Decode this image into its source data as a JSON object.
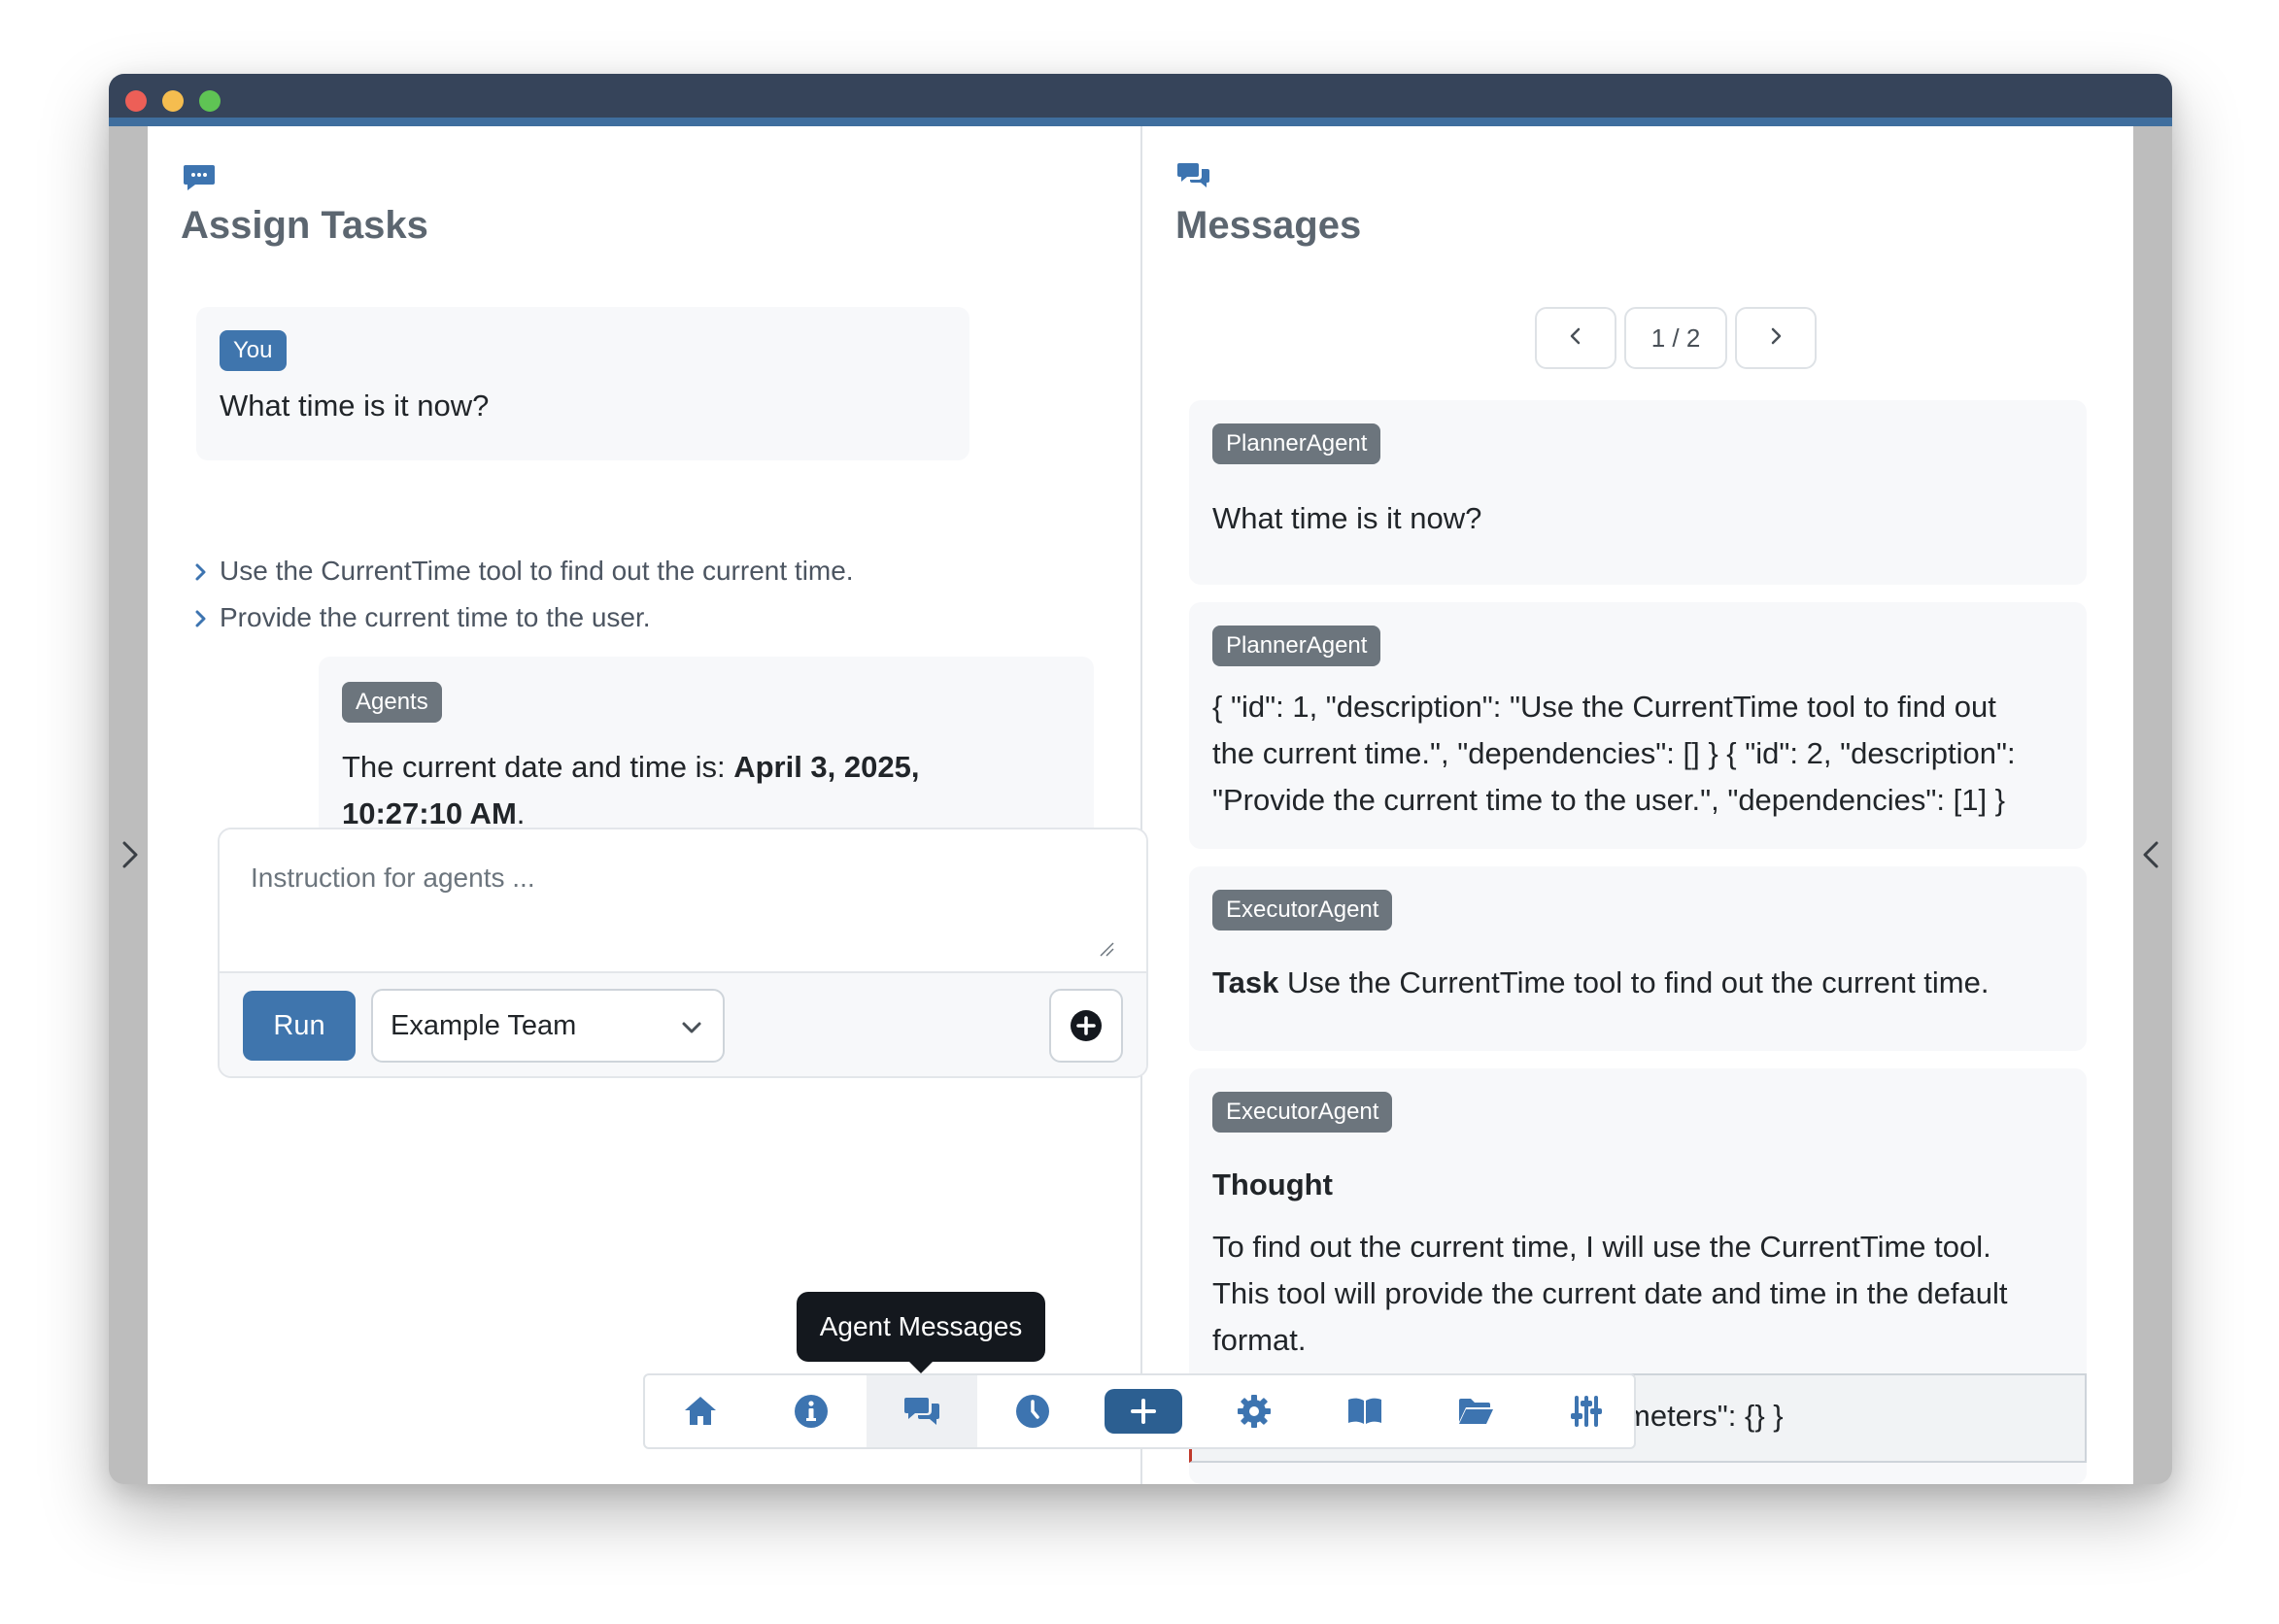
{
  "left_panel": {
    "title": "Assign Tasks",
    "user_message": {
      "badge": "You",
      "text": "What time is it now?"
    },
    "plan_steps": [
      "Use the CurrentTime tool to find out the current time.",
      "Provide the current time to the user."
    ],
    "agent_reply": {
      "badge": "Agents",
      "prefix": "The current date and time is: ",
      "bold_line1": "April 3, 2025,",
      "bold_line2": "10:27:10 AM",
      "suffix": "."
    },
    "instruction_placeholder": "Instruction for agents ...",
    "run_label": "Run",
    "team_selected": "Example Team"
  },
  "right_panel": {
    "title": "Messages",
    "pager": {
      "label": "1 / 2",
      "current": 1,
      "total": 2
    },
    "messages": [
      {
        "sender": "PlannerAgent",
        "text": "What time is it now?"
      },
      {
        "sender": "PlannerAgent",
        "lines": [
          "{ \"id\": 1, \"description\": \"Use the CurrentTime tool to find out",
          "the current time.\", \"dependencies\": [] } { \"id\": 2, \"description\":",
          "\"Provide the current time to the user.\", \"dependencies\": [1] }"
        ]
      },
      {
        "sender": "ExecutorAgent",
        "bold": "Task",
        "text": " Use the CurrentTime tool to find out the current time."
      },
      {
        "sender": "ExecutorAgent",
        "heading": "Thought",
        "lines": [
          "To find out the current time, I will use the CurrentTime tool.",
          "This tool will provide the current date and time in the default",
          "format."
        ]
      }
    ],
    "partial_code": "meters\": {} }"
  },
  "tooltip": "Agent Messages",
  "nav_icons": [
    "home-icon",
    "info-icon",
    "messages-icon",
    "clock-icon",
    "plus-icon",
    "gear-icon",
    "book-icon",
    "folder-icon",
    "sliders-icon"
  ],
  "colors": {
    "accent": "#3f75ad",
    "titlebar": "#36445a",
    "badge_gray": "#6c757d",
    "tooltip": "#14181e"
  }
}
